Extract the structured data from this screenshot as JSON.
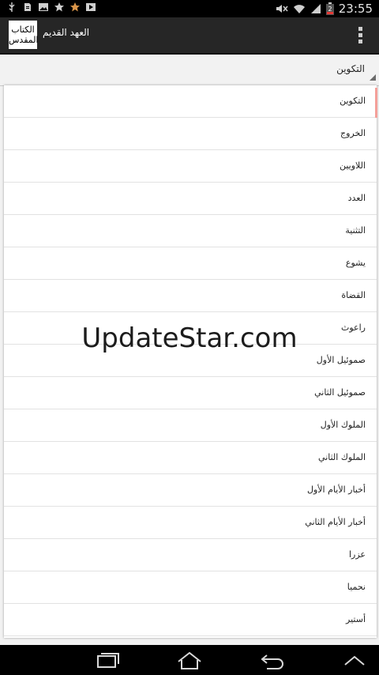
{
  "status_bar": {
    "time": "23:55",
    "battery_level": "2"
  },
  "app": {
    "logo_line1": "الكتاب",
    "logo_line2": "المقدس",
    "title": "العهد القديم"
  },
  "spinner": {
    "selected": "التكوين"
  },
  "dropdown": {
    "items": [
      "التكوين",
      "الخروج",
      "اللاويين",
      "العدد",
      "التثنية",
      "يشوع",
      "القضاة",
      "راعوث",
      "صموئيل الأول",
      "صموئيل الثاني",
      "الملوك الأول",
      "الملوك الثاني",
      "أخبار الأيام الأول",
      "أخبار الأيام الثاني",
      "عزرا",
      "نحميا",
      "أستير"
    ]
  },
  "watermark": {
    "text": "UpdateStar.com"
  },
  "icons": {
    "status_left": [
      "usb-icon",
      "sd-card-icon",
      "image-icon",
      "star-icon",
      "star-icon",
      "play-store-icon"
    ],
    "status_right": [
      "mute-icon",
      "wifi-icon",
      "signal-icon",
      "battery-icon"
    ],
    "nav": [
      "recent-apps-icon",
      "home-icon",
      "back-icon",
      "up-icon"
    ]
  },
  "colors": {
    "action_bar": "#262626",
    "accent_scroll": "#f4a09a"
  }
}
